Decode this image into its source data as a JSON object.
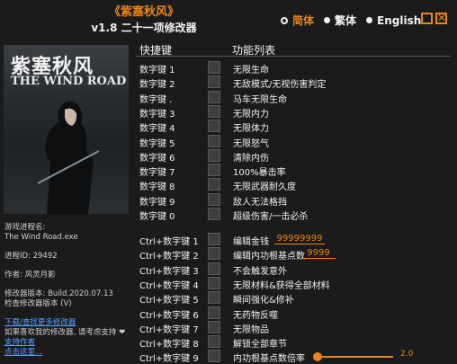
{
  "header": {
    "game_title": "《紫塞秋风》",
    "version_title": "v1.8 二十一项修改器",
    "languages": [
      {
        "label": "简体",
        "active": true
      },
      {
        "label": "繁体",
        "active": false
      },
      {
        "label": "English",
        "active": false
      }
    ]
  },
  "cover": {
    "title_cn": "紫塞秋风",
    "title_en": "THE WIND ROAD"
  },
  "info": {
    "process_label": "游戏进程名:",
    "process_value": "The Wind Road.exe",
    "pid_line": "进程ID: 29492",
    "author_line": "作者: 风灵月影",
    "version_line": "修改器版本: Build.2020.07.13",
    "update_link": "检查修改器版本 (V)",
    "download_link": "下载/查找更多修改器",
    "support_text": "如果喜欢我的修改器, 请考虑支持 ❤",
    "support_link": "支持作者",
    "extra_link": "点击这里..."
  },
  "columns": {
    "hotkey": "快捷键",
    "functions": "功能列表"
  },
  "cheats": [
    {
      "key": "数字键 1",
      "name": "无限生命"
    },
    {
      "key": "数字键 2",
      "name": "无敌模式/无视伤害判定"
    },
    {
      "key": "数字键 .",
      "name": "马车无限生命"
    },
    {
      "key": "数字键 3",
      "name": "无限内力"
    },
    {
      "key": "数字键 4",
      "name": "无限体力"
    },
    {
      "key": "数字键 5",
      "name": "无限怒气"
    },
    {
      "key": "数字键 6",
      "name": "清除内伤"
    },
    {
      "key": "数字键 7",
      "name": "100%暴击率"
    },
    {
      "key": "数字键 8",
      "name": "无限武器耐久度"
    },
    {
      "key": "数字键 9",
      "name": "敌人无法格挡"
    },
    {
      "key": "数字键 0",
      "name": "超级伤害/一击必杀"
    },
    {
      "key": "Ctrl+数字键 1",
      "name": "编辑金钱",
      "value": "99999999"
    },
    {
      "key": "Ctrl+数字键 2",
      "name": "编辑内功根基点数",
      "value": "9999"
    },
    {
      "key": "Ctrl+数字键 3",
      "name": "不会触发意外"
    },
    {
      "key": "Ctrl+数字键 4",
      "name": "无限材料&获得全部材料"
    },
    {
      "key": "Ctrl+数字键 5",
      "name": "瞬间强化&修补"
    },
    {
      "key": "Ctrl+数字键 6",
      "name": "无药物反噬"
    },
    {
      "key": "Ctrl+数字键 7",
      "name": "无限物品"
    },
    {
      "key": "Ctrl+数字键 8",
      "name": "解锁全部章节"
    },
    {
      "key": "Ctrl+数字键 9",
      "name": "内功根基点数倍率",
      "slider_value": "2.0",
      "slider_fraction": 0
    }
  ],
  "colors": {
    "accent": "#e8851c",
    "background": "#1b1b1b",
    "link": "#5aa0ff"
  }
}
